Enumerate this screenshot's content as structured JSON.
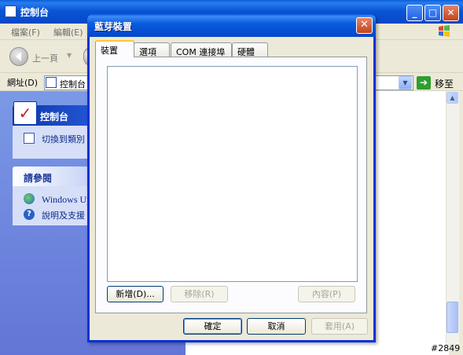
{
  "background_window": {
    "title": "控制台",
    "menu": [
      "檔案(F)",
      "編輯(E)"
    ],
    "back_label": "上一頁",
    "address_label": "網址(D)",
    "address_value": "控制台",
    "go_label": "移至"
  },
  "task_pane": {
    "control_panel_header": "控制台",
    "switch_link": "切換到類別",
    "see_also_header": "請參閱",
    "see_also_links": [
      "Windows Up",
      "說明及支援"
    ]
  },
  "dialog": {
    "title": "藍芽裝置",
    "tabs": [
      {
        "label": "裝置",
        "active": true
      },
      {
        "label": "選項",
        "active": false
      },
      {
        "label": "COM 連接埠",
        "active": false
      },
      {
        "label": "硬體",
        "active": false
      }
    ],
    "device_list_items": [],
    "buttons": {
      "add": "新增(D)...",
      "remove": "移除(R)",
      "properties": "內容(P)",
      "ok": "確定",
      "cancel": "取消",
      "apply": "套用(A)"
    }
  },
  "watermark": "#2849",
  "colors": {
    "title_bar_blue": "#0a5fd8",
    "close_red": "#c2441c",
    "dialog_face": "#ece9d8",
    "active_tab_highlight": "#ffc83c",
    "task_pane_blue": "#7a99e6"
  }
}
